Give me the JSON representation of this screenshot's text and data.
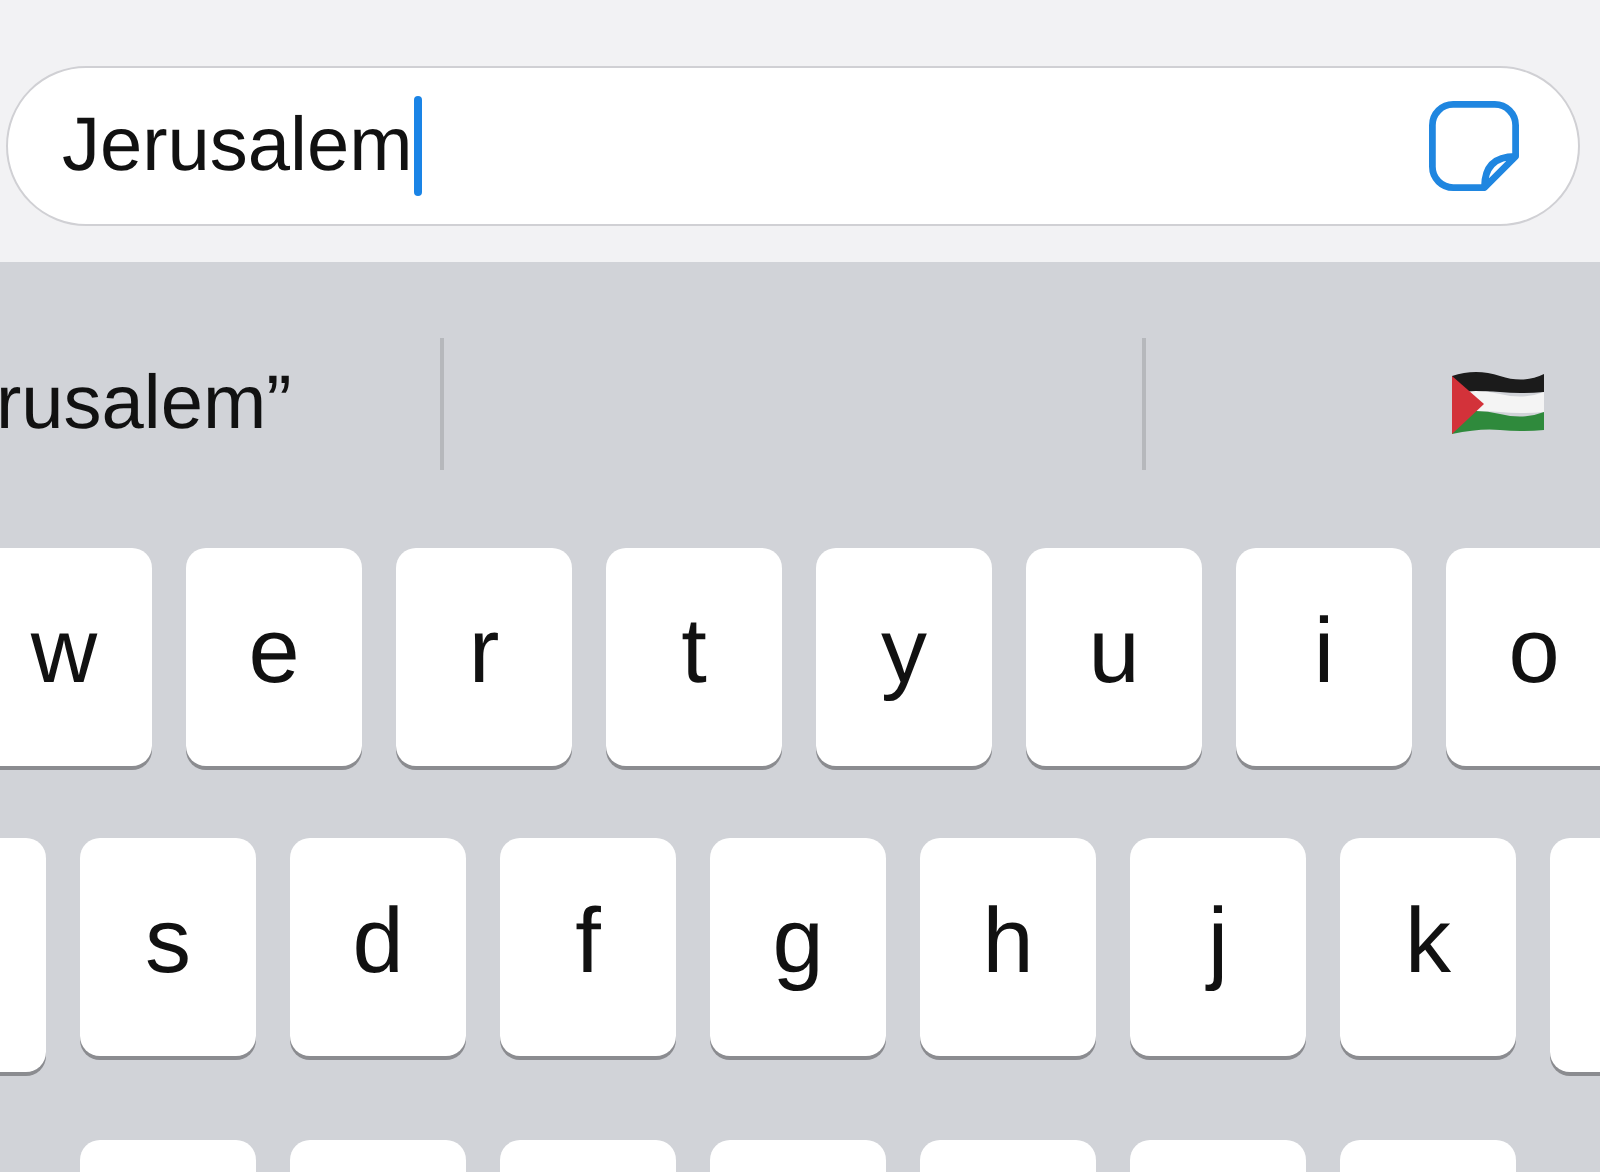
{
  "search_field": {
    "value": "Jerusalem",
    "focused": true
  },
  "suggestions": [
    {
      "text": "rusalem”"
    },
    {
      "kind": "empty"
    },
    {
      "kind": "flag"
    }
  ],
  "key_rows": [
    {
      "keys": [
        "w",
        "e",
        "r",
        "t",
        "y",
        "u",
        "i",
        "o"
      ]
    },
    {
      "keys": [
        "s",
        "d",
        "f",
        "g",
        "h",
        "j",
        "k"
      ]
    }
  ]
}
